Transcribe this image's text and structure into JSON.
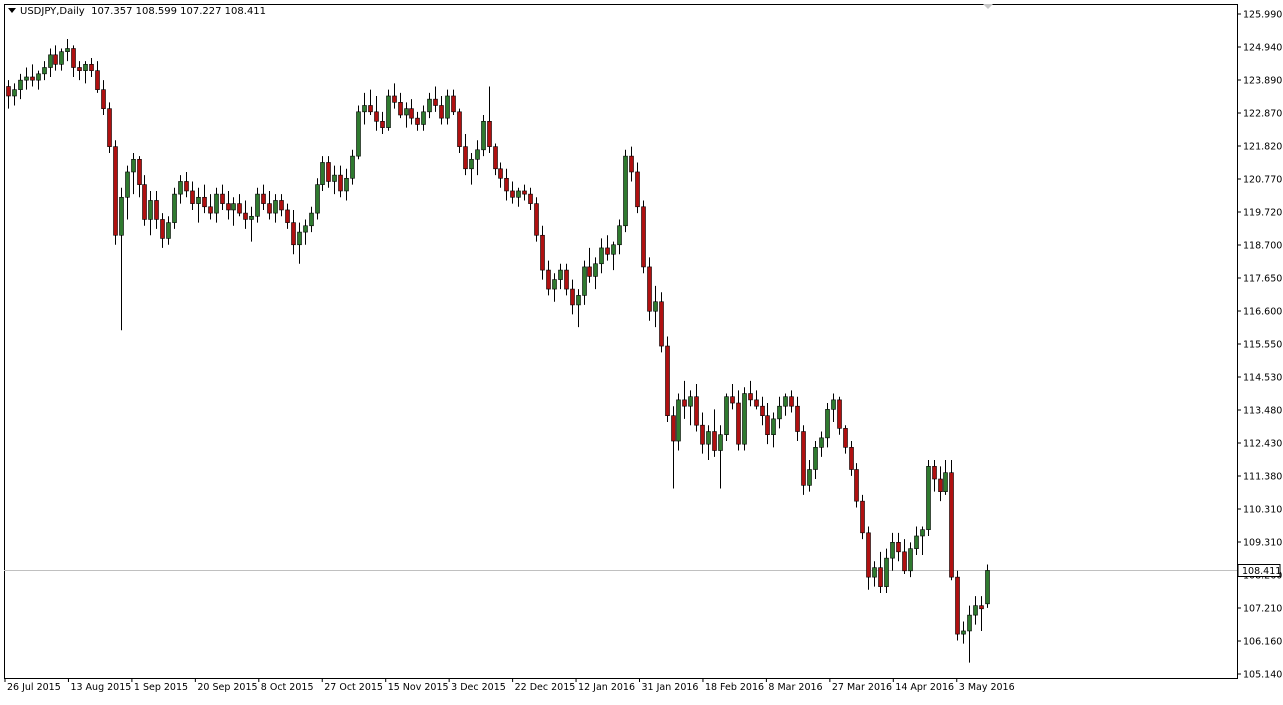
{
  "header": {
    "symbol": "USDJPY,Daily",
    "ohlc": "107.357 108.599 107.227 108.411"
  },
  "current_price_label": "108.411",
  "colors": {
    "bull": "#2f7a2f",
    "bear": "#b01010",
    "wick": "#000000",
    "price_line": "#c0c0c0",
    "label_bg": "#ffffff"
  },
  "chart_data": {
    "type": "candlestick",
    "title": "",
    "xlabel": "",
    "ylabel": "",
    "ylim": [
      105.14,
      125.99
    ],
    "y_ticks": [
      "125.990",
      "124.940",
      "123.890",
      "122.870",
      "121.820",
      "120.770",
      "119.720",
      "118.700",
      "117.650",
      "116.600",
      "115.550",
      "114.530",
      "113.480",
      "112.430",
      "111.380",
      "110.310",
      "109.310",
      "108.260",
      "107.210",
      "106.160",
      "105.140"
    ],
    "x_ticks": [
      "26 Jul 2015",
      "13 Aug 2015",
      "1 Sep 2015",
      "20 Sep 2015",
      "8 Oct 2015",
      "27 Oct 2015",
      "15 Nov 2015",
      "3 Dec 2015",
      "22 Dec 2015",
      "12 Jan 2016",
      "31 Jan 2016",
      "18 Feb 2016",
      "8 Mar 2016",
      "27 Mar 2016",
      "14 Apr 2016",
      "3 May 2016"
    ],
    "last_price": 108.411,
    "candles": [
      [
        123.7,
        123.9,
        123.0,
        123.4
      ],
      [
        123.4,
        123.8,
        123.1,
        123.6
      ],
      [
        123.6,
        124.1,
        123.3,
        123.9
      ],
      [
        123.9,
        124.3,
        123.6,
        124.0
      ],
      [
        124.0,
        124.4,
        123.7,
        123.9
      ],
      [
        123.9,
        124.2,
        123.6,
        124.1
      ],
      [
        124.1,
        124.5,
        123.9,
        124.3
      ],
      [
        124.3,
        124.9,
        124.0,
        124.7
      ],
      [
        124.7,
        125.0,
        124.2,
        124.4
      ],
      [
        124.4,
        124.9,
        124.2,
        124.8
      ],
      [
        124.8,
        125.2,
        124.5,
        124.9
      ],
      [
        124.9,
        125.0,
        124.0,
        124.3
      ],
      [
        124.3,
        124.5,
        123.9,
        124.2
      ],
      [
        124.2,
        124.5,
        123.8,
        124.4
      ],
      [
        124.4,
        124.6,
        124.0,
        124.2
      ],
      [
        124.2,
        124.5,
        123.5,
        123.6
      ],
      [
        123.6,
        123.9,
        122.8,
        123.0
      ],
      [
        123.0,
        123.2,
        121.6,
        121.8
      ],
      [
        121.8,
        122.0,
        118.7,
        119.0
      ],
      [
        119.0,
        120.5,
        116.0,
        120.2
      ],
      [
        120.2,
        121.2,
        119.5,
        121.0
      ],
      [
        121.0,
        121.6,
        120.3,
        121.4
      ],
      [
        121.4,
        121.5,
        120.2,
        120.6
      ],
      [
        120.6,
        120.9,
        119.3,
        119.5
      ],
      [
        119.5,
        120.4,
        119.0,
        120.1
      ],
      [
        120.1,
        120.4,
        119.2,
        119.5
      ],
      [
        119.5,
        119.7,
        118.6,
        118.9
      ],
      [
        118.9,
        119.6,
        118.7,
        119.4
      ],
      [
        119.4,
        120.5,
        119.2,
        120.3
      ],
      [
        120.3,
        120.9,
        120.0,
        120.7
      ],
      [
        120.7,
        121.0,
        120.2,
        120.4
      ],
      [
        120.4,
        120.7,
        119.8,
        120.0
      ],
      [
        120.0,
        120.5,
        119.4,
        120.2
      ],
      [
        120.2,
        120.6,
        119.7,
        119.9
      ],
      [
        119.9,
        120.3,
        119.5,
        119.7
      ],
      [
        119.7,
        120.5,
        119.4,
        120.3
      ],
      [
        120.3,
        120.6,
        119.8,
        120.0
      ],
      [
        120.0,
        120.4,
        119.5,
        119.8
      ],
      [
        119.8,
        120.2,
        119.3,
        120.0
      ],
      [
        120.0,
        120.3,
        119.6,
        119.7
      ],
      [
        119.7,
        120.1,
        119.2,
        119.5
      ],
      [
        119.5,
        119.9,
        118.8,
        119.6
      ],
      [
        119.6,
        120.5,
        119.4,
        120.3
      ],
      [
        120.3,
        120.6,
        119.8,
        120.0
      ],
      [
        120.0,
        120.4,
        119.5,
        119.7
      ],
      [
        119.7,
        120.3,
        119.4,
        120.1
      ],
      [
        120.1,
        120.3,
        119.6,
        119.8
      ],
      [
        119.8,
        120.0,
        119.2,
        119.4
      ],
      [
        119.4,
        119.8,
        118.4,
        118.7
      ],
      [
        118.7,
        119.4,
        118.1,
        119.1
      ],
      [
        119.1,
        119.5,
        118.7,
        119.3
      ],
      [
        119.3,
        119.9,
        119.1,
        119.7
      ],
      [
        119.7,
        120.8,
        119.5,
        120.6
      ],
      [
        120.6,
        121.5,
        120.4,
        121.3
      ],
      [
        121.3,
        121.5,
        120.5,
        120.7
      ],
      [
        120.7,
        121.2,
        120.3,
        120.9
      ],
      [
        120.9,
        121.2,
        120.2,
        120.4
      ],
      [
        120.4,
        121.1,
        120.1,
        120.8
      ],
      [
        120.8,
        121.7,
        120.6,
        121.5
      ],
      [
        121.5,
        123.1,
        121.4,
        122.9
      ],
      [
        122.9,
        123.5,
        122.5,
        123.1
      ],
      [
        123.1,
        123.6,
        122.8,
        122.9
      ],
      [
        122.9,
        123.4,
        122.3,
        122.6
      ],
      [
        122.6,
        122.9,
        122.2,
        122.4
      ],
      [
        122.4,
        123.6,
        122.3,
        123.4
      ],
      [
        123.4,
        123.8,
        123.0,
        123.2
      ],
      [
        123.2,
        123.5,
        122.7,
        122.8
      ],
      [
        122.8,
        123.2,
        122.4,
        123.0
      ],
      [
        123.0,
        123.3,
        122.5,
        122.7
      ],
      [
        122.7,
        122.9,
        122.3,
        122.5
      ],
      [
        122.5,
        123.1,
        122.3,
        122.9
      ],
      [
        122.9,
        123.5,
        122.7,
        123.3
      ],
      [
        123.3,
        123.7,
        122.9,
        123.1
      ],
      [
        123.1,
        123.4,
        122.5,
        122.7
      ],
      [
        122.7,
        123.6,
        122.5,
        123.4
      ],
      [
        123.4,
        123.6,
        122.8,
        122.9
      ],
      [
        122.9,
        123.0,
        121.6,
        121.8
      ],
      [
        121.8,
        122.2,
        120.9,
        121.1
      ],
      [
        121.1,
        121.6,
        120.6,
        121.4
      ],
      [
        121.4,
        122.0,
        120.9,
        121.7
      ],
      [
        121.7,
        122.8,
        121.5,
        122.6
      ],
      [
        122.6,
        123.7,
        121.6,
        121.8
      ],
      [
        121.8,
        121.9,
        120.9,
        121.1
      ],
      [
        121.1,
        121.3,
        120.5,
        120.8
      ],
      [
        120.8,
        121.1,
        120.1,
        120.4
      ],
      [
        120.4,
        120.7,
        120.0,
        120.2
      ],
      [
        120.2,
        120.5,
        119.9,
        120.4
      ],
      [
        120.4,
        120.6,
        120.1,
        120.3
      ],
      [
        120.3,
        120.5,
        119.8,
        120.0
      ],
      [
        120.0,
        120.2,
        118.8,
        119.0
      ],
      [
        119.0,
        119.3,
        117.6,
        117.9
      ],
      [
        117.9,
        118.2,
        117.1,
        117.3
      ],
      [
        117.3,
        117.8,
        116.9,
        117.6
      ],
      [
        117.6,
        118.1,
        117.3,
        117.9
      ],
      [
        117.9,
        118.1,
        117.1,
        117.3
      ],
      [
        117.3,
        117.6,
        116.5,
        116.8
      ],
      [
        116.8,
        117.3,
        116.1,
        117.1
      ],
      [
        117.1,
        118.2,
        116.8,
        118.0
      ],
      [
        118.0,
        118.6,
        117.5,
        117.7
      ],
      [
        117.7,
        118.3,
        117.3,
        118.1
      ],
      [
        118.1,
        118.9,
        117.8,
        118.6
      ],
      [
        118.6,
        119.0,
        118.2,
        118.4
      ],
      [
        118.4,
        118.8,
        117.9,
        118.7
      ],
      [
        118.7,
        119.5,
        118.4,
        119.3
      ],
      [
        119.3,
        121.7,
        119.1,
        121.5
      ],
      [
        121.5,
        121.8,
        120.7,
        121.0
      ],
      [
        121.0,
        121.3,
        119.7,
        119.9
      ],
      [
        119.9,
        120.1,
        117.8,
        118.0
      ],
      [
        118.0,
        118.3,
        116.3,
        116.6
      ],
      [
        116.6,
        117.4,
        116.1,
        116.9
      ],
      [
        116.9,
        117.2,
        115.3,
        115.5
      ],
      [
        115.5,
        115.8,
        113.1,
        113.3
      ],
      [
        113.3,
        113.6,
        111.0,
        112.5
      ],
      [
        112.5,
        114.0,
        112.2,
        113.8
      ],
      [
        113.8,
        114.4,
        113.2,
        113.6
      ],
      [
        113.6,
        114.1,
        113.0,
        113.9
      ],
      [
        113.9,
        114.3,
        112.8,
        113.0
      ],
      [
        113.0,
        113.4,
        112.1,
        112.4
      ],
      [
        112.4,
        113.0,
        111.9,
        112.8
      ],
      [
        112.8,
        113.5,
        112.0,
        112.2
      ],
      [
        112.2,
        113.0,
        111.0,
        112.7
      ],
      [
        112.7,
        114.0,
        112.5,
        113.9
      ],
      [
        113.9,
        114.3,
        113.5,
        113.7
      ],
      [
        113.7,
        114.1,
        112.2,
        112.4
      ],
      [
        112.4,
        114.2,
        112.2,
        114.0
      ],
      [
        114.0,
        114.4,
        113.6,
        113.8
      ],
      [
        113.8,
        114.1,
        113.5,
        113.6
      ],
      [
        113.6,
        113.9,
        113.0,
        113.3
      ],
      [
        113.3,
        113.7,
        112.4,
        112.7
      ],
      [
        112.7,
        113.4,
        112.3,
        113.2
      ],
      [
        113.2,
        113.9,
        112.9,
        113.6
      ],
      [
        113.6,
        114.0,
        113.3,
        113.9
      ],
      [
        113.9,
        114.1,
        113.4,
        113.6
      ],
      [
        113.6,
        113.9,
        112.5,
        112.8
      ],
      [
        112.8,
        113.0,
        110.8,
        111.1
      ],
      [
        111.1,
        111.9,
        110.9,
        111.6
      ],
      [
        111.6,
        112.5,
        111.3,
        112.3
      ],
      [
        112.3,
        112.8,
        112.0,
        112.6
      ],
      [
        112.6,
        113.7,
        112.3,
        113.5
      ],
      [
        113.5,
        114.0,
        113.1,
        113.8
      ],
      [
        113.8,
        113.9,
        112.7,
        112.9
      ],
      [
        112.9,
        113.0,
        112.1,
        112.3
      ],
      [
        112.3,
        112.5,
        111.4,
        111.6
      ],
      [
        111.6,
        111.8,
        110.4,
        110.6
      ],
      [
        110.6,
        110.8,
        109.4,
        109.6
      ],
      [
        109.6,
        109.8,
        107.8,
        108.2
      ],
      [
        108.2,
        108.7,
        107.9,
        108.5
      ],
      [
        108.5,
        109.0,
        107.7,
        107.9
      ],
      [
        107.9,
        109.1,
        107.7,
        108.8
      ],
      [
        108.8,
        109.6,
        108.4,
        109.3
      ],
      [
        109.3,
        109.6,
        108.7,
        109.0
      ],
      [
        109.0,
        109.4,
        108.3,
        108.4
      ],
      [
        108.4,
        109.3,
        108.2,
        109.1
      ],
      [
        109.1,
        109.8,
        108.9,
        109.5
      ],
      [
        109.5,
        109.8,
        108.9,
        109.7
      ],
      [
        109.7,
        111.9,
        109.5,
        111.7
      ],
      [
        111.7,
        111.9,
        110.9,
        111.3
      ],
      [
        111.3,
        111.7,
        110.6,
        110.9
      ],
      [
        110.9,
        111.9,
        110.8,
        111.5
      ],
      [
        111.5,
        111.9,
        108.1,
        108.2
      ],
      [
        108.2,
        108.4,
        106.2,
        106.4
      ],
      [
        106.4,
        106.8,
        106.1,
        106.5
      ],
      [
        106.5,
        107.3,
        105.5,
        107.0
      ],
      [
        107.0,
        107.6,
        106.7,
        107.3
      ],
      [
        107.3,
        107.6,
        106.5,
        107.2
      ],
      [
        107.357,
        108.599,
        107.227,
        108.411
      ]
    ]
  }
}
